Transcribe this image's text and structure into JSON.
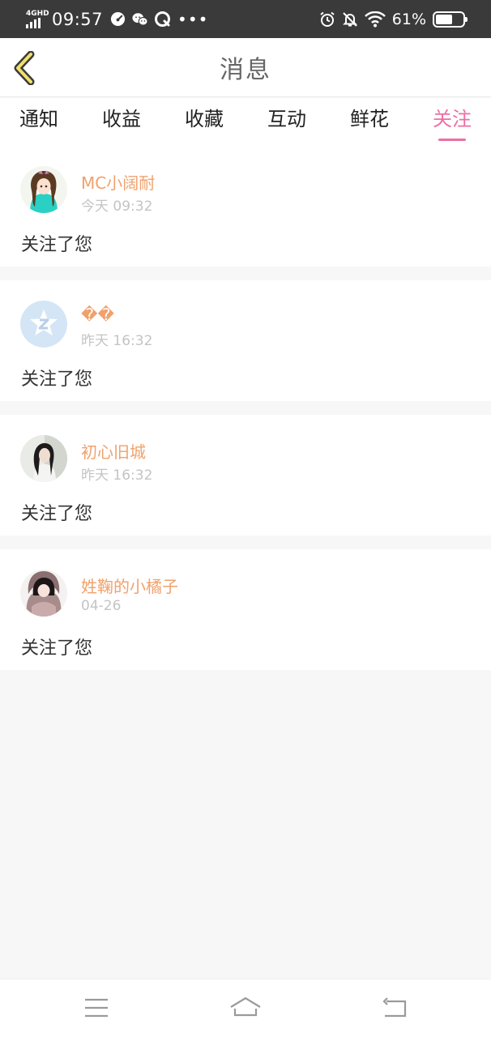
{
  "status_bar": {
    "network": "4GHD",
    "time": "09:57",
    "battery": "61%",
    "battery_level": 0.61,
    "icons": [
      "speedometer-icon",
      "wechat-icon",
      "qq-icon",
      "more-dots-icon",
      "alarm-icon",
      "mute-bell-icon",
      "wifi-icon",
      "battery-icon"
    ]
  },
  "header": {
    "title": "消息",
    "back_icon": "chevron-left-icon"
  },
  "tabs": [
    {
      "label": "通知",
      "active": false
    },
    {
      "label": "收益",
      "active": false
    },
    {
      "label": "收藏",
      "active": false
    },
    {
      "label": "互动",
      "active": false
    },
    {
      "label": "鲜花",
      "active": false
    },
    {
      "label": "关注",
      "active": true
    }
  ],
  "messages": [
    {
      "name": "MC小阔耐",
      "time": "今天 09:32",
      "text": "关注了您",
      "avatar": "anime-girl-avatar"
    },
    {
      "name": "��",
      "time": "昨天 16:32",
      "text": "关注了您",
      "avatar": "default-z-avatar"
    },
    {
      "name": "初心旧城",
      "time": "昨天 16:32",
      "text": "关注了您",
      "avatar": "girl-photo-avatar"
    },
    {
      "name": "姓鞠的小橘子",
      "time": "04-26",
      "text": "关注了您",
      "avatar": "anime-hoodie-avatar"
    }
  ],
  "nav": {
    "menu_icon": "menu-icon",
    "home_icon": "home-icon",
    "back_icon": "return-icon"
  },
  "colors": {
    "accent": "#ec6fa4",
    "username": "#f0a16c",
    "status_bar": "#3a3a3a",
    "back_chevron": "#f2e06a"
  }
}
